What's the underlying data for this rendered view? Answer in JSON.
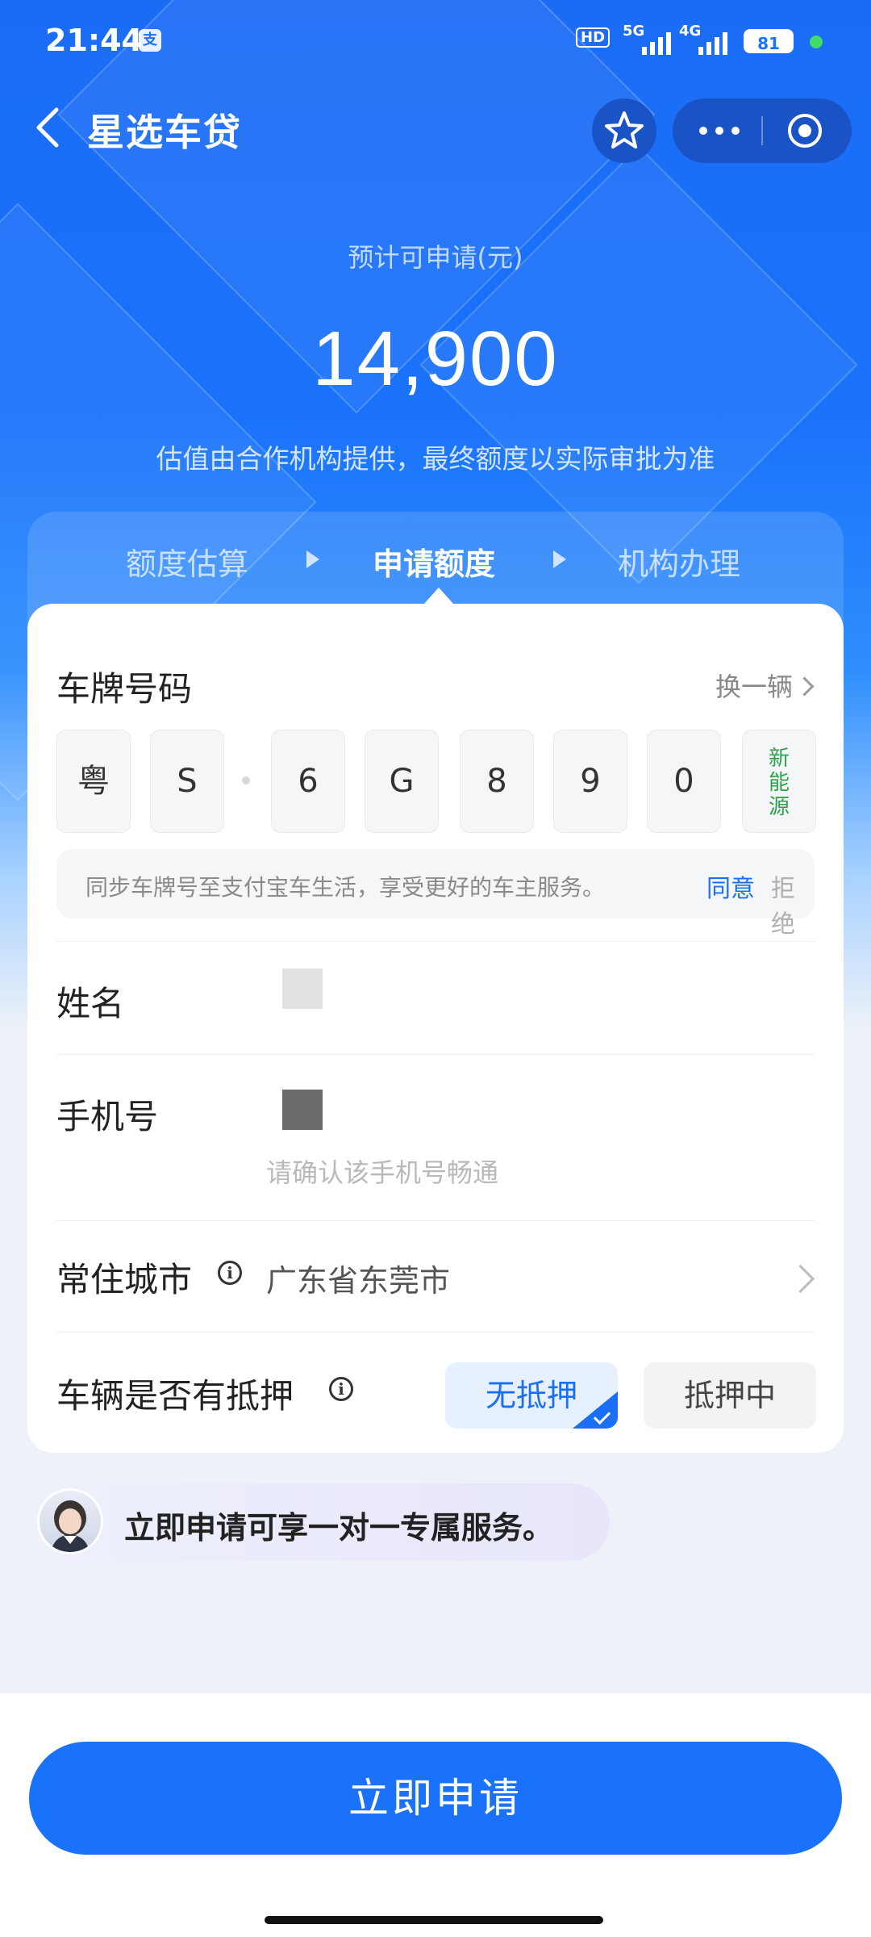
{
  "status_bar": {
    "time": "21:44",
    "app_badge": "支",
    "hd_label": "HD",
    "signal1": "5G",
    "signal2": "4G",
    "battery": "81"
  },
  "nav": {
    "title": "星选车贷"
  },
  "estimate": {
    "label": "预计可申请(元)",
    "amount": "14,900",
    "note": "估值由合作机构提供，最终额度以实际审批为准"
  },
  "steps": [
    {
      "label": "额度估算"
    },
    {
      "label": "申请额度"
    },
    {
      "label": "机构办理"
    }
  ],
  "form": {
    "plate": {
      "label": "车牌号码",
      "switch_label": "换一辆",
      "chars": [
        "粤",
        "S",
        "6",
        "G",
        "8",
        "9",
        "0"
      ],
      "ev_label": [
        "新",
        "能",
        "源"
      ],
      "sync_text": "同步车牌号至支付宝车生活，享受更好的车主服务。",
      "agree": "同意",
      "refuse": "拒绝"
    },
    "name": {
      "label": "姓名"
    },
    "phone": {
      "label": "手机号",
      "hint": "请确认该手机号畅通"
    },
    "city": {
      "label": "常住城市",
      "value": "广东省东莞市"
    },
    "mortgage": {
      "label": "车辆是否有抵押",
      "options": [
        "无抵押",
        "抵押中"
      ],
      "selected": "无抵押"
    }
  },
  "service_banner": {
    "text": "立即申请可享一对一专属服务。"
  },
  "apply_button": "立即申请",
  "colors": {
    "primary": "#1a72fb",
    "ev_green": "#2aa34a"
  }
}
